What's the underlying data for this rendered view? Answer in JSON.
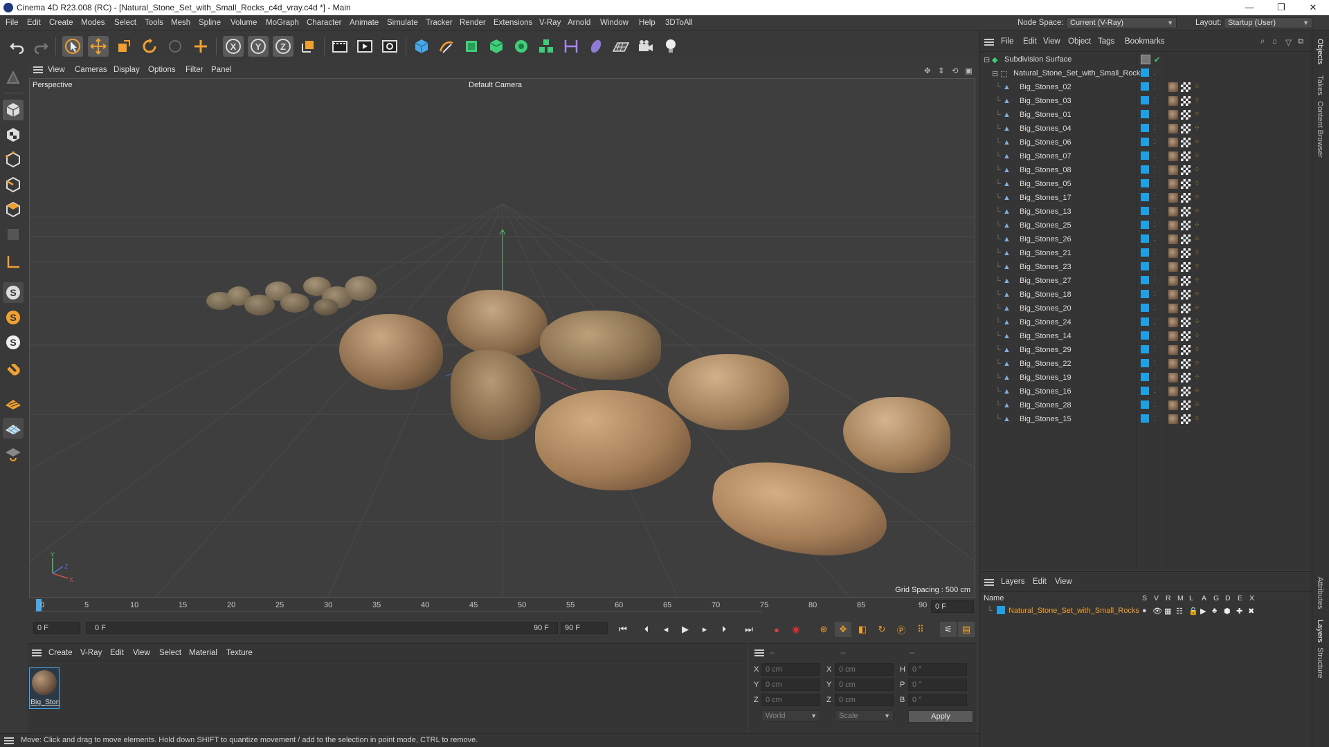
{
  "window": {
    "title": "Cinema 4D R23.008 (RC) - [Natural_Stone_Set_with_Small_Rocks_c4d_vray.c4d *] - Main"
  },
  "menu": [
    "File",
    "Edit",
    "Create",
    "Modes",
    "Select",
    "Tools",
    "Mesh",
    "Spline",
    "Volume",
    "MoGraph",
    "Character",
    "Animate",
    "Simulate",
    "Tracker",
    "Render",
    "Extensions",
    "V-Ray",
    "Arnold",
    "Window",
    "Help",
    "3DToAll"
  ],
  "node_space": {
    "label": "Node Space:",
    "value": "Current (V-Ray)"
  },
  "layout": {
    "label": "Layout:",
    "value": "Startup (User)"
  },
  "viewport": {
    "menu": [
      "View",
      "Cameras",
      "Display",
      "Options",
      "Filter",
      "Panel"
    ],
    "label": "Perspective",
    "camera": "Default Camera",
    "grid_spacing": "Grid Spacing : 500 cm"
  },
  "timeline": {
    "ticks": [
      "0",
      "5",
      "10",
      "15",
      "20",
      "25",
      "30",
      "35",
      "40",
      "45",
      "50",
      "55",
      "60",
      "65",
      "70",
      "75",
      "80",
      "85",
      "90"
    ],
    "end_field": "0 F",
    "current": "0 F",
    "range_start": "0 F",
    "range_end": "90 F",
    "max": "90 F"
  },
  "material_panel": {
    "menu": [
      "Create",
      "V-Ray",
      "Edit",
      "View",
      "Select",
      "Material",
      "Texture"
    ],
    "materials": [
      {
        "name": "Big_Ston"
      }
    ]
  },
  "coords": {
    "headers": [
      "--",
      "--",
      "--"
    ],
    "rows": [
      {
        "a": "X",
        "av": "0 cm",
        "b": "X",
        "bv": "0 cm",
        "c": "H",
        "cv": "0 °"
      },
      {
        "a": "Y",
        "av": "0 cm",
        "b": "Y",
        "bv": "0 cm",
        "c": "P",
        "cv": "0 °"
      },
      {
        "a": "Z",
        "av": "0 cm",
        "b": "Z",
        "bv": "0 cm",
        "c": "B",
        "cv": "0 °"
      }
    ],
    "mode": "World",
    "scale": "Scale",
    "apply": "Apply"
  },
  "status": "Move: Click and drag to move elements. Hold down SHIFT to quantize movement / add to the selection in point mode, CTRL to remove.",
  "object_manager": {
    "menu": [
      "File",
      "Edit",
      "View",
      "Object",
      "Tags",
      "Bookmarks"
    ],
    "root": "Subdivision Surface",
    "group": "Natural_Stone_Set_with_Small_Rocks",
    "objects": [
      "Big_Stones_02",
      "Big_Stones_03",
      "Big_Stones_01",
      "Big_Stones_04",
      "Big_Stones_06",
      "Big_Stones_07",
      "Big_Stones_08",
      "Big_Stones_05",
      "Big_Stones_17",
      "Big_Stones_13",
      "Big_Stones_25",
      "Big_Stones_26",
      "Big_Stones_21",
      "Big_Stones_23",
      "Big_Stones_27",
      "Big_Stones_18",
      "Big_Stones_20",
      "Big_Stones_24",
      "Big_Stones_14",
      "Big_Stones_29",
      "Big_Stones_22",
      "Big_Stones_19",
      "Big_Stones_16",
      "Big_Stones_28",
      "Big_Stones_15"
    ]
  },
  "layer_manager": {
    "menu": [
      "Layers",
      "Edit",
      "View"
    ],
    "name_header": "Name",
    "flags": [
      "S",
      "V",
      "R",
      "M",
      "L",
      "A",
      "G",
      "D",
      "E",
      "X"
    ],
    "layers": [
      "Natural_Stone_Set_with_Small_Rocks"
    ]
  },
  "side_tabs": [
    "Objects",
    "Takes",
    "Content Browser",
    "Attributes",
    "Layers",
    "Structure"
  ],
  "colors": {
    "accent": "#1ea0e6",
    "layer_name": "#f0a030",
    "viewport_bg": "#3e3e3e"
  }
}
